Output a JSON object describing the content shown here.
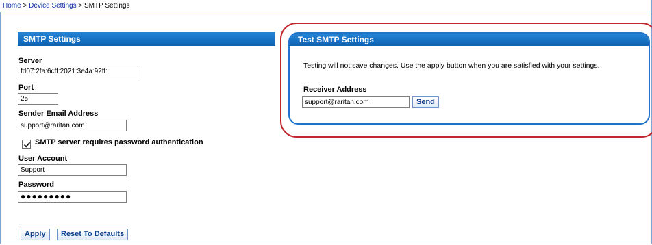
{
  "breadcrumb": {
    "home": "Home",
    "separator": ">",
    "device_settings": "Device Settings",
    "current": "SMTP Settings"
  },
  "smtp": {
    "header": "SMTP Settings",
    "server_label": "Server",
    "server_value": "fd07:2fa:6cff:2021:3e4a:92ff:",
    "port_label": "Port",
    "port_value": "25",
    "sender_label": "Sender Email Address",
    "sender_value": "support@raritan.com",
    "auth_checkbox_label": "SMTP server requires password authentication",
    "auth_checked": true,
    "user_label": "User Account",
    "user_value": "Support",
    "password_label": "Password",
    "password_value": "●●●●●●●●●",
    "apply_label": "Apply",
    "reset_label": "Reset To Defaults"
  },
  "test": {
    "header": "Test SMTP Settings",
    "description": "Testing will not save changes. Use the apply button when you are satisfied with your settings.",
    "receiver_label": "Receiver Address",
    "receiver_value": "support@raritan.com",
    "send_label": "Send"
  },
  "colors": {
    "header_blue": "#1071c6",
    "link_blue": "#0a2fa8",
    "highlight_red": "#c2272d"
  }
}
